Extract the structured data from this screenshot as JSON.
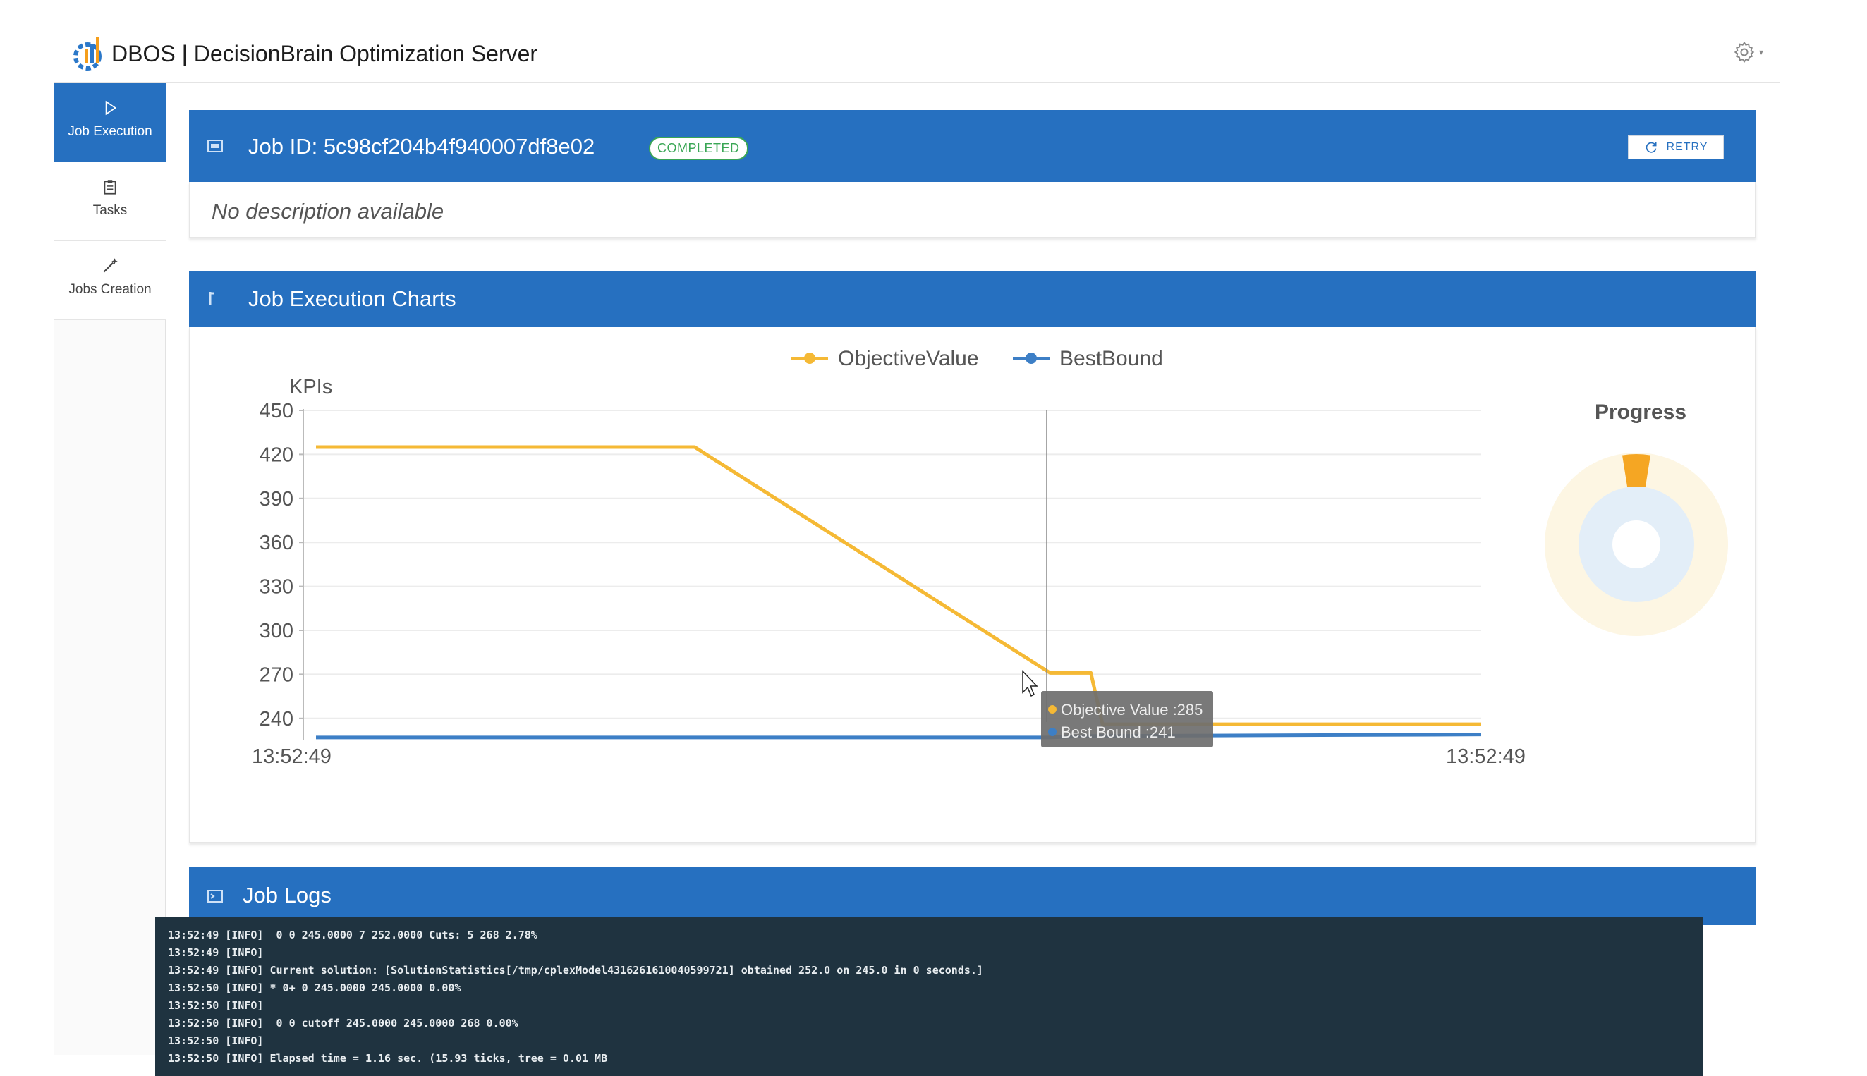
{
  "app": {
    "title": "DBOS | DecisionBrain Optimization Server"
  },
  "sidebar": {
    "items": [
      {
        "label": "Job Execution",
        "icon": "play-icon",
        "active": true
      },
      {
        "label": "Tasks",
        "icon": "clipboard-icon",
        "active": false
      },
      {
        "label": "Jobs Creation",
        "icon": "magic-wand-icon",
        "active": false
      }
    ]
  },
  "job": {
    "id_label": "Job ID: 5c98cf204b4f940007df8e02",
    "status": "COMPLETED",
    "retry_label": "RETRY",
    "description": "No description available"
  },
  "charts_panel": {
    "title": "Job Execution Charts",
    "progress_title": "Progress",
    "progress_value": 0.05
  },
  "tooltip": {
    "objective": "Objective Value :285",
    "bound": "Best Bound :241"
  },
  "colors": {
    "brand_blue": "#2670c0",
    "objective": "#f5b935",
    "bound": "#3d7fc6",
    "completed_green": "#3aa655"
  },
  "chart_data": {
    "type": "line",
    "ylabel": "KPIs",
    "ylim": [
      225,
      450
    ],
    "y_ticks": [
      450,
      420,
      390,
      360,
      330,
      300,
      270,
      240
    ],
    "x_tick_labels": [
      "13:52:49",
      "13:52:49"
    ],
    "x": [
      0,
      0.325,
      0.63,
      0.665,
      0.675,
      1.0
    ],
    "series": [
      {
        "name": "ObjectiveValue",
        "color": "#f5b935",
        "values": [
          425,
          425,
          271,
          271,
          236,
          236
        ]
      },
      {
        "name": "BestBound",
        "color": "#3d7fc6",
        "values": [
          227,
          227,
          227,
          228,
          228,
          229
        ]
      }
    ],
    "legend": "top-center",
    "grid": true
  },
  "logs": {
    "title": "Job Logs",
    "lines": [
      "13:52:49 [INFO]  0 0 245.0000 7 252.0000 Cuts: 5 268 2.78%",
      "13:52:49 [INFO]",
      "13:52:49 [INFO] Current solution: [SolutionStatistics[/tmp/cplexModel4316261610040599721] obtained 252.0 on 245.0 in 0 seconds.]",
      "13:52:50 [INFO] * 0+ 0 245.0000 245.0000 0.00%",
      "13:52:50 [INFO]",
      "13:52:50 [INFO]  0 0 cutoff 245.0000 245.0000 268 0.00%",
      "13:52:50 [INFO]",
      "13:52:50 [INFO] Elapsed time = 1.16 sec. (15.93 ticks, tree = 0.01 MB"
    ]
  }
}
